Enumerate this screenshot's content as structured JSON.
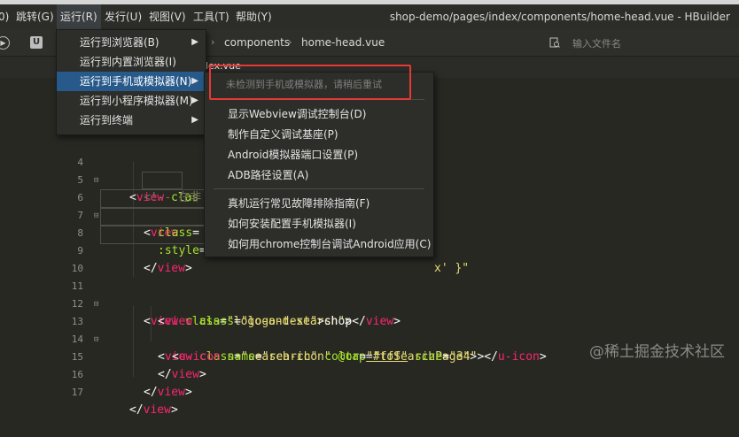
{
  "menubar": {
    "items": [
      "0)",
      "跳转(G)",
      "运行(R)",
      "发行(U)",
      "视图(V)",
      "工具(T)",
      "帮助(Y)"
    ],
    "window_title": "shop-demo/pages/index/components/home-head.vue - HBuilder"
  },
  "toolbar": {
    "breadcrumb": [
      "components",
      "home-head.vue"
    ],
    "file_search_placeholder": "输入文件名"
  },
  "tab": {
    "label": "lex.vue"
  },
  "run_menu": {
    "items": [
      {
        "label": "运行到浏览器(B)"
      },
      {
        "label": "运行到内置浏览器(I)"
      },
      {
        "label": "运行到手机或模拟器(N)"
      },
      {
        "label": "运行到小程序模拟器(M)"
      },
      {
        "label": "运行到终端"
      }
    ]
  },
  "device_submenu": {
    "notice": "未检测到手机或模拟器，请稍后重试",
    "group1": [
      "显示Webview调试控制台(D)",
      "制作自定义调试基座(P)",
      "Android模拟器端口设置(P)",
      "ADB路径设置(A)"
    ],
    "group2": [
      "真机运行常见故障排除指南(F)",
      "如何安装配置手机模拟器(I)",
      "如何用chrome控制台调试Android应用(C)"
    ]
  },
  "editor": {
    "line_numbers": [
      "4",
      "5",
      "6",
      "7",
      "8",
      "9",
      "10",
      "11",
      "12",
      "13",
      "14",
      "15",
      "16",
      "17"
    ],
    "code": {
      "l4_a": "<",
      "l4_tag": "view",
      "l4_b": " clas",
      "l5": "<!-- 在非",
      "l6_a": "<",
      "l6_tag": "view",
      "l7_attr": "class",
      "l7_eq": "=",
      "l8_a": ":style",
      "l8_b": "=",
      "l8_c": "x' }\"",
      "l9_a": "</",
      "l9_tag": "view",
      "l9_b": ">",
      "l11_a": "<",
      "l11_tag": "view",
      "l11_sp": " ",
      "l11_attr": "class",
      "l11_eq": "=",
      "l11_val": "\"logo-and-search\"",
      "l11_end": ">",
      "l12_a": "<",
      "l12_tag": "view",
      "l12_sp": " ",
      "l12_attr": "class",
      "l12_eq": "=",
      "l12_val": "\"logo-text\"",
      "l12_gt": ">",
      "l12_text": "shop",
      "l12_close1": "</",
      "l12_close_tag": "view",
      "l12_close2": ">",
      "l13_a": "<",
      "l13_tag": "view",
      "l13_sp": " ",
      "l13_attr": "class",
      "l13_eq": "=",
      "l13_val": "\"search-icon\"",
      "l13_sp2": " ",
      "l13_attr2": "@tap",
      "l13_eq2": "=",
      "l13_val2": "\"toSearchPage\"",
      "l13_end": ">",
      "l14_a": "<",
      "l14_tag": "u-icon",
      "l14_sp": " ",
      "l14_attr": "name",
      "l14_eq": "=",
      "l14_val": "\"search\"",
      "l14_sp2": " ",
      "l14_attr2": "color",
      "l14_eq2": "=",
      "l14_val2": "\"#fff\"",
      "l14_sp3": " ",
      "l14_attr3": "size",
      "l14_eq3": "=",
      "l14_val3": "\"34\"",
      "l14_gt": ">",
      "l14_close1": "</",
      "l14_close_tag": "u-icon",
      "l14_close2": ">",
      "l15_a": "</",
      "l15_tag": "view",
      "l15_b": ">",
      "l16_a": "</",
      "l16_tag": "view",
      "l16_b": ">",
      "l17_a": "</",
      "l17_tag": "view",
      "l17_b": ">"
    }
  },
  "watermark": "@稀土掘金技术社区",
  "colors": {
    "menu_highlight": "#275a8a",
    "annotation": "#e53935",
    "editor_bg": "#272822"
  }
}
